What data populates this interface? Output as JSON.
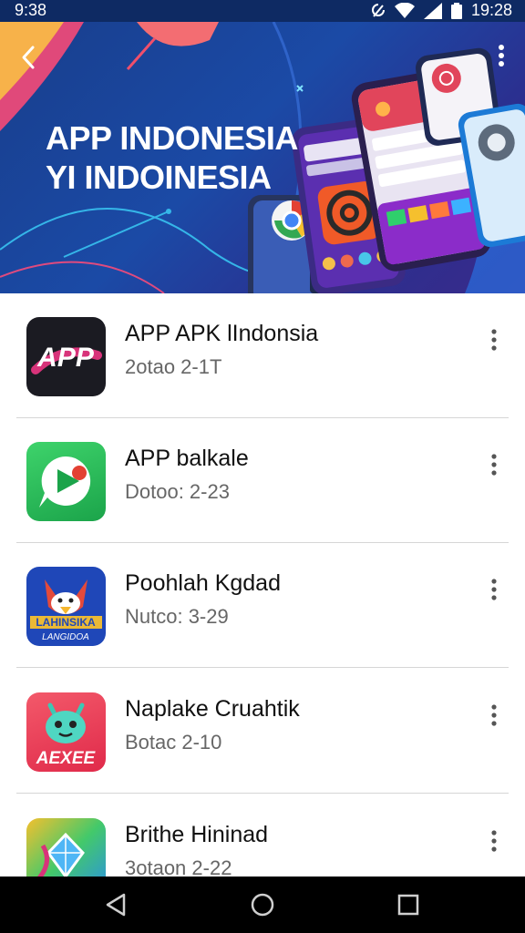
{
  "status": {
    "time_left": "9:38",
    "time_right": "19:28"
  },
  "hero": {
    "title_line1": "APP INDONESIA",
    "title_line2": "YI INDOINESIA"
  },
  "apps": [
    {
      "name": "APP APK lIndonsia",
      "subtitle": "2otao 2-1T",
      "icon_text": "APP"
    },
    {
      "name": "APP balkale",
      "subtitle": "Dotoo: 2-23",
      "icon_text": ""
    },
    {
      "name": "Poohlah Kgdad",
      "subtitle": "Nutco: 3-29",
      "icon_text": "LAHINSIKA",
      "icon_text2": "LANGIDOA"
    },
    {
      "name": "Naplake Cruahtik",
      "subtitle": "Botac 2-10",
      "icon_text": "AEXEE"
    },
    {
      "name": "Brithe Hininad",
      "subtitle": "3otaon 2-22",
      "icon_text": ""
    }
  ]
}
